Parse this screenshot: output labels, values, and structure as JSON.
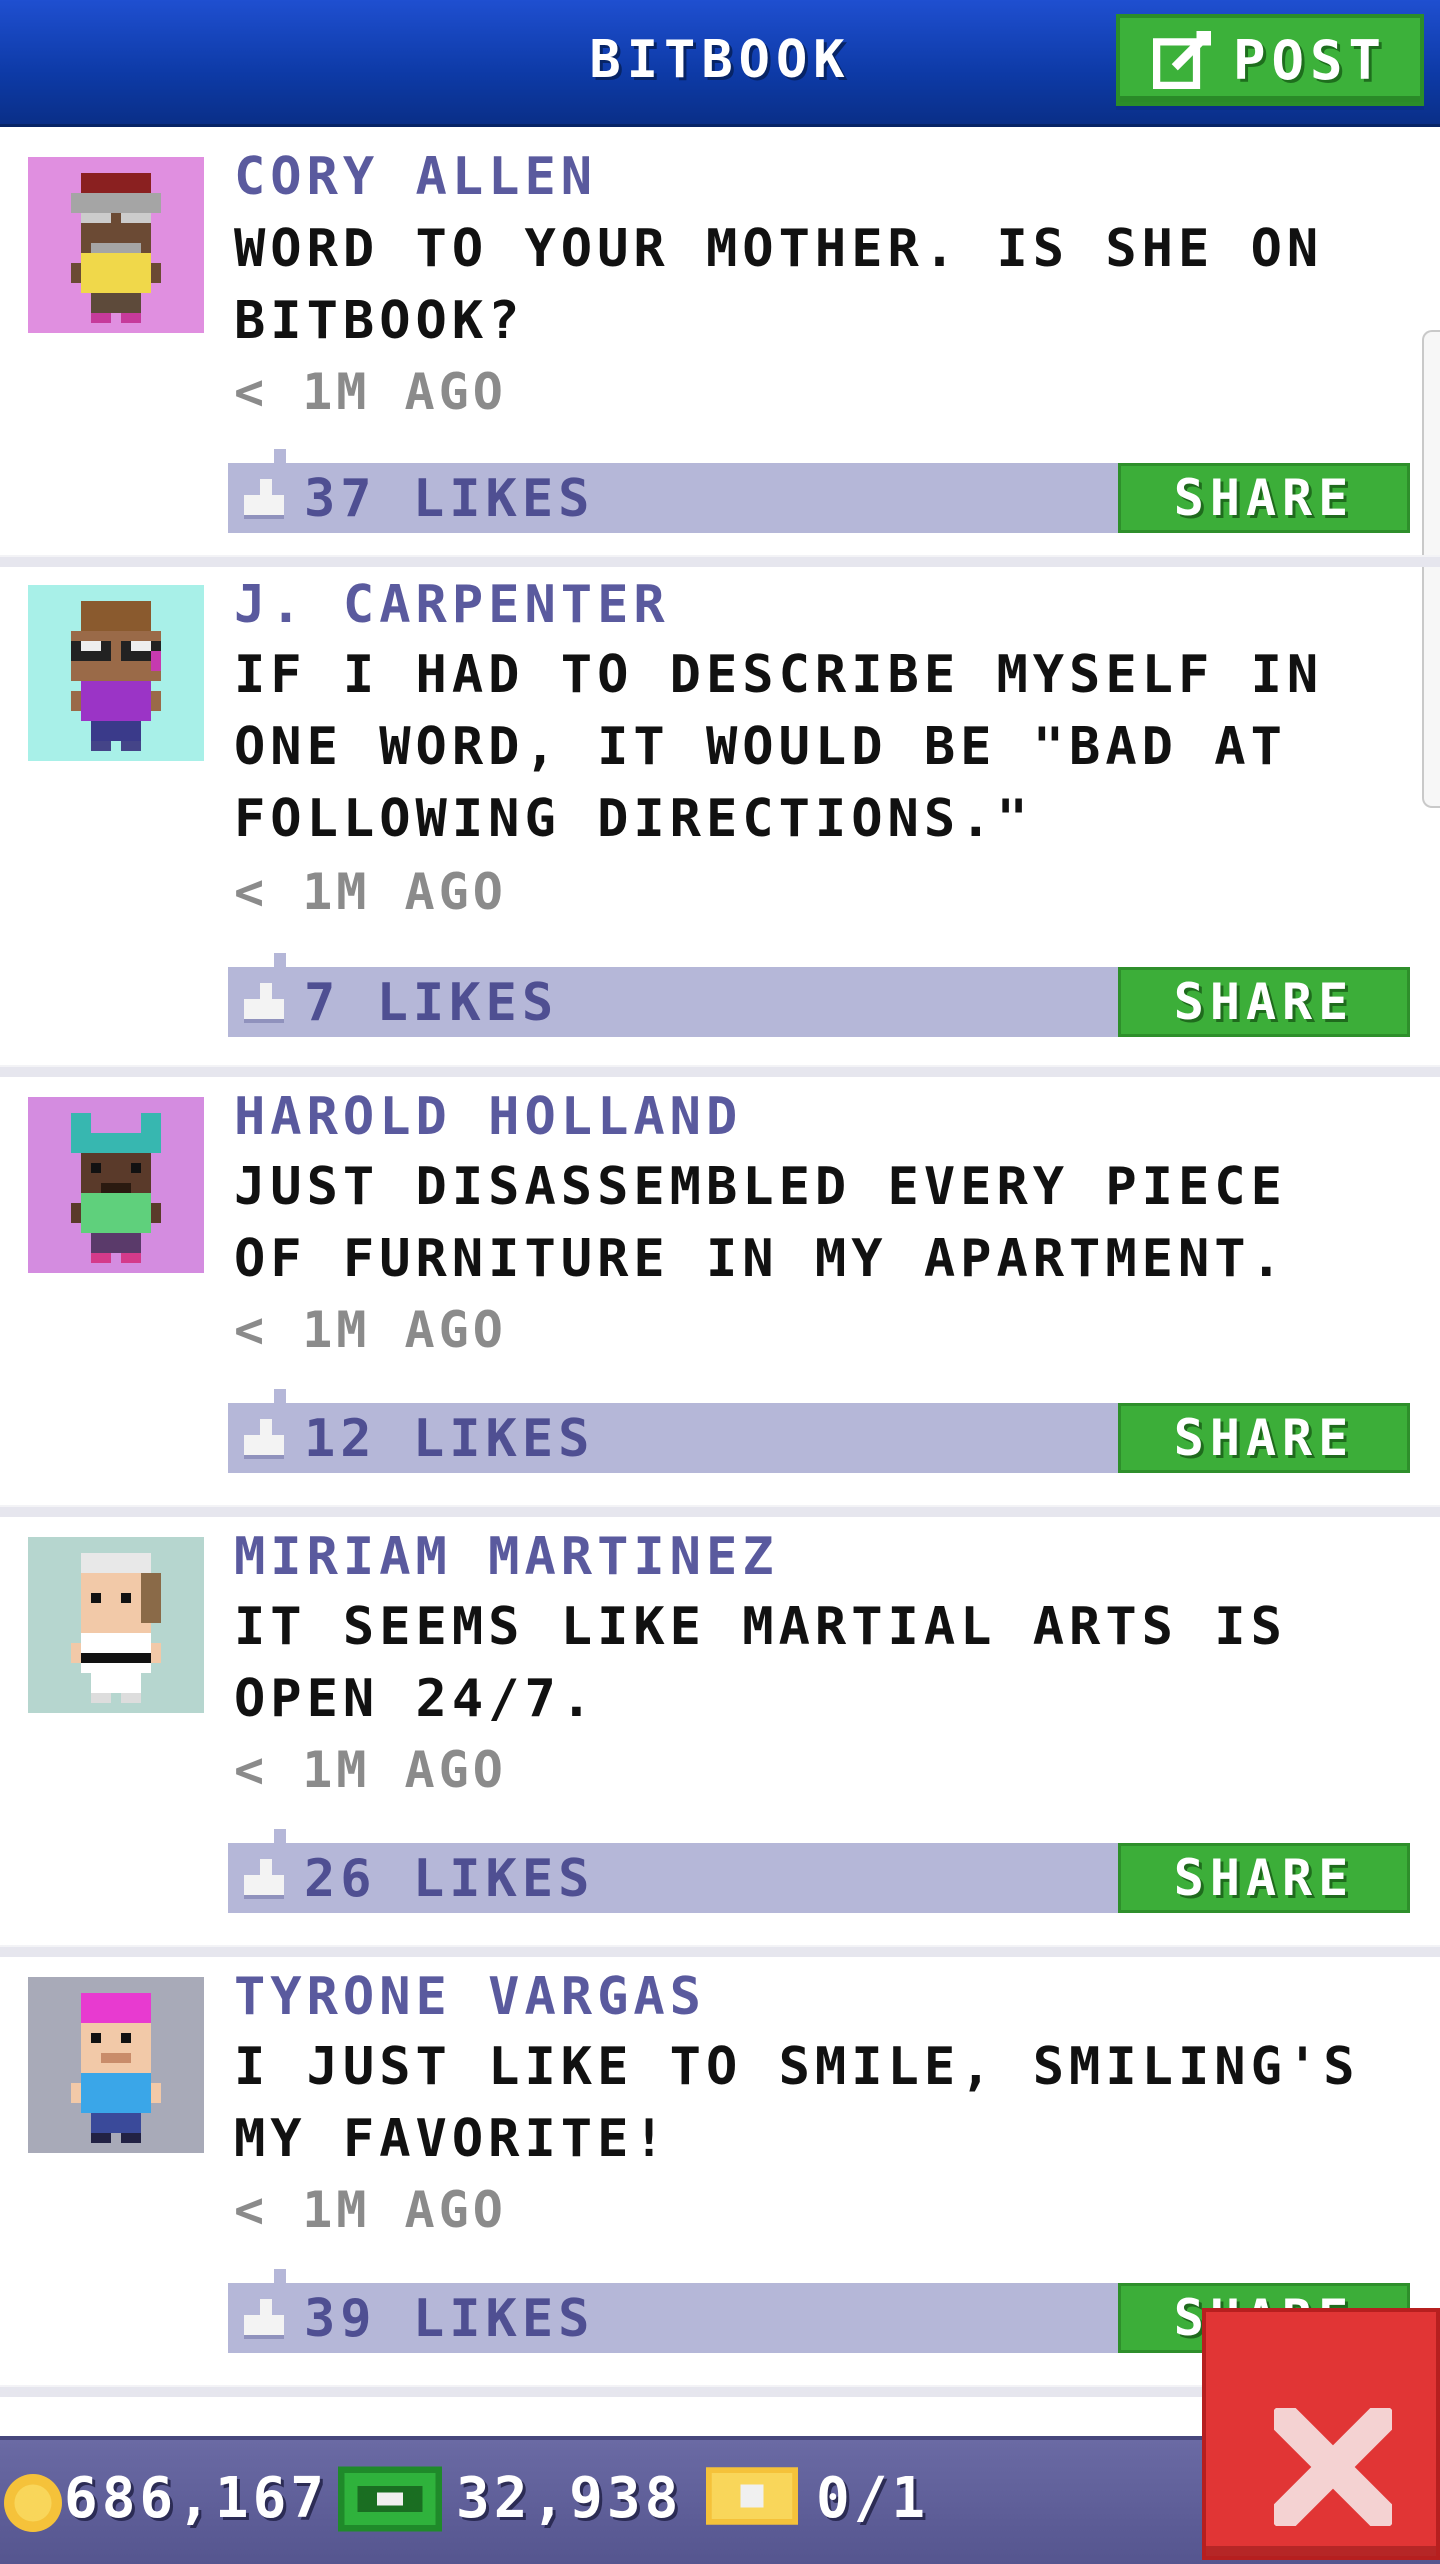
{
  "header": {
    "title": "BITBOOK",
    "post_label": "POST"
  },
  "colors": {
    "header_blue": "#0d3aa6",
    "green_button": "#3cae39",
    "likes_bar": "#b5b7d8",
    "author_text": "#5a5a9e",
    "close_red": "#e13535"
  },
  "posts": [
    {
      "author": "CORY ALLEN",
      "message": "WORD TO YOUR MOTHER. IS SHE ON BITBOOK?",
      "time": "< 1M AGO",
      "likes": "37 LIKES",
      "share_label": "SHARE",
      "avatar_bg": "#e08fe0"
    },
    {
      "author": "J. CARPENTER",
      "message": "IF I HAD TO DESCRIBE MYSELF IN ONE WORD, IT WOULD BE \"BAD AT FOLLOWING DIRECTIONS.\"",
      "time": "< 1M AGO",
      "likes": "7 LIKES",
      "share_label": "SHARE",
      "avatar_bg": "#a8f0e8"
    },
    {
      "author": "HAROLD HOLLAND",
      "message": "JUST DISASSEMBLED EVERY PIECE OF FURNITURE IN MY APARTMENT.",
      "time": "< 1M AGO",
      "likes": "12 LIKES",
      "share_label": "SHARE",
      "avatar_bg": "#d48ce0"
    },
    {
      "author": "MIRIAM MARTINEZ",
      "message": "IT SEEMS LIKE MARTIAL ARTS IS OPEN 24/7.",
      "time": "< 1M AGO",
      "likes": "26 LIKES",
      "share_label": "SHARE",
      "avatar_bg": "#b6d6cf"
    },
    {
      "author": "TYRONE VARGAS",
      "message": "I JUST LIKE TO SMILE, SMILING'S MY FAVORITE!",
      "time": "< 1M AGO",
      "likes": "39 LIKES",
      "share_label": "SHARE",
      "avatar_bg": "#a8aab8"
    }
  ],
  "bottom_bar": {
    "coins": "686,167",
    "bux": "32,938",
    "tickets": "0/1"
  },
  "icons": {
    "post": "edit-icon",
    "like": "thumbs-up-icon",
    "coin": "coin-icon",
    "bux": "bux-icon",
    "ticket": "ticket-icon",
    "close": "close-icon"
  }
}
